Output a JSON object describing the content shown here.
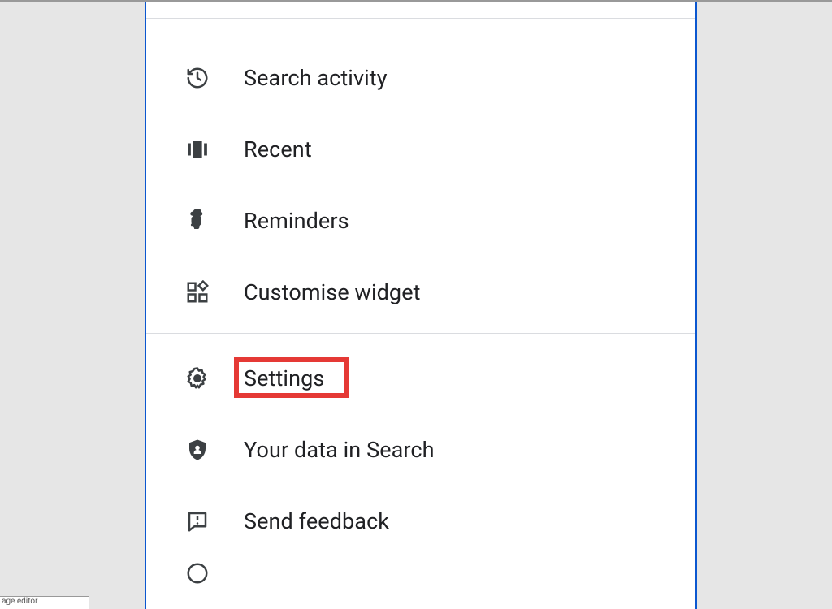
{
  "menu": {
    "group1": [
      {
        "id": "search-activity",
        "label": "Search activity",
        "icon": "history-icon"
      },
      {
        "id": "recent",
        "label": "Recent",
        "icon": "carousel-icon"
      },
      {
        "id": "reminders",
        "label": "Reminders",
        "icon": "reminder-finger-icon"
      },
      {
        "id": "customise-widget",
        "label": "Customise widget",
        "icon": "widgets-icon"
      }
    ],
    "group2": [
      {
        "id": "settings",
        "label": "Settings",
        "icon": "gear-icon",
        "highlighted": true
      },
      {
        "id": "your-data-in-search",
        "label": "Your data in Search",
        "icon": "privacy-shield-icon"
      },
      {
        "id": "send-feedback",
        "label": "Send feedback",
        "icon": "feedback-icon"
      }
    ]
  },
  "colors": {
    "highlight": "#e53935",
    "panel_border": "#0b57d0",
    "text": "#202124",
    "icon": "#3c4043"
  },
  "status_bar_snippet": "age editor"
}
